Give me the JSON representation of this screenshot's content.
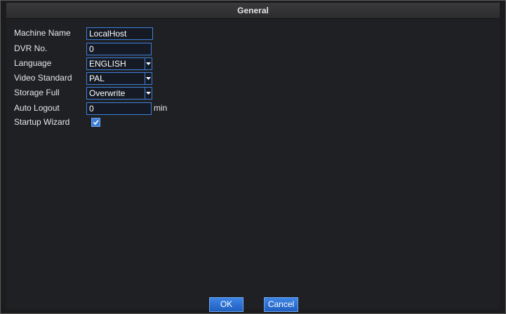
{
  "dialog": {
    "title": "General"
  },
  "form": {
    "machine_name": {
      "label": "Machine Name",
      "value": "LocalHost"
    },
    "dvr_no": {
      "label": "DVR No.",
      "value": "0"
    },
    "language": {
      "label": "Language",
      "value": "ENGLISH",
      "icon": "chevron-down-icon"
    },
    "video_standard": {
      "label": "Video Standard",
      "value": "PAL",
      "icon": "chevron-down-icon"
    },
    "storage_full": {
      "label": "Storage Full",
      "value": "Overwrite",
      "icon": "chevron-down-icon"
    },
    "auto_logout": {
      "label": "Auto Logout",
      "value": "0",
      "unit": "min"
    },
    "startup_wizard": {
      "label": "Startup Wizard",
      "checked": true,
      "icon": "checkmark-icon"
    }
  },
  "buttons": {
    "ok": "OK",
    "cancel": "Cancel"
  },
  "colors": {
    "accent": "#3f7fd8",
    "background": "#1f2023"
  }
}
